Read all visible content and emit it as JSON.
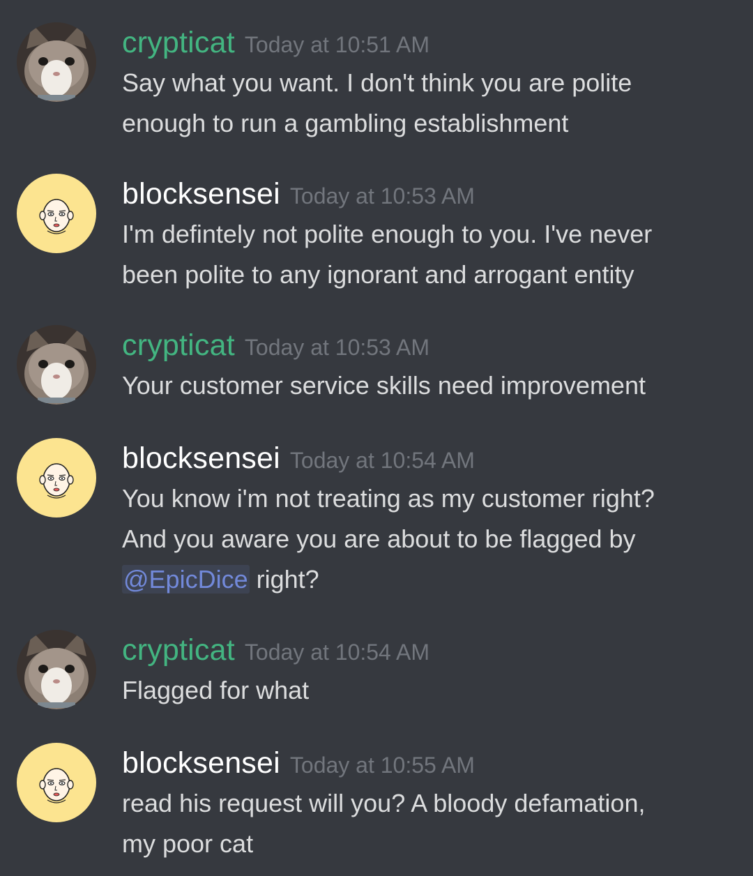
{
  "colors": {
    "background": "#36393f",
    "author_green": "#43b581",
    "author_white": "#ffffff",
    "timestamp": "#72767d",
    "message_text": "#dcddde",
    "mention": "#7289da"
  },
  "messages": [
    {
      "author": "crypticat",
      "avatar": "cat-avatar-icon",
      "timestamp": "Today at 10:51 AM",
      "lines": [
        "Say what you want. I don't think you are polite",
        "enough to run a gambling establishment"
      ]
    },
    {
      "author": "blocksensei",
      "avatar": "bald-man-avatar-icon",
      "timestamp": "Today at 10:53 AM",
      "lines": [
        "I'm defintely not polite enough to you. I've never",
        "been polite to any ignorant and arrogant entity"
      ]
    },
    {
      "author": "crypticat",
      "avatar": "cat-avatar-icon",
      "timestamp": "Today at 10:53 AM",
      "lines": [
        "Your customer service skills need improvement"
      ]
    },
    {
      "author": "blocksensei",
      "avatar": "bald-man-avatar-icon",
      "timestamp": "Today at 10:54 AM",
      "lines": [
        "You know i'm not treating as my customer right?",
        "And you aware you are about to be flagged by"
      ],
      "mention": "@EpicDice",
      "after_mention": "right?"
    },
    {
      "author": "crypticat",
      "avatar": "cat-avatar-icon",
      "timestamp": "Today at 10:54 AM",
      "lines": [
        "Flagged for what"
      ]
    },
    {
      "author": "blocksensei",
      "avatar": "bald-man-avatar-icon",
      "timestamp": "Today at 10:55 AM",
      "lines": [
        "read his request will you? A bloody defamation,",
        "my poor cat"
      ]
    }
  ]
}
